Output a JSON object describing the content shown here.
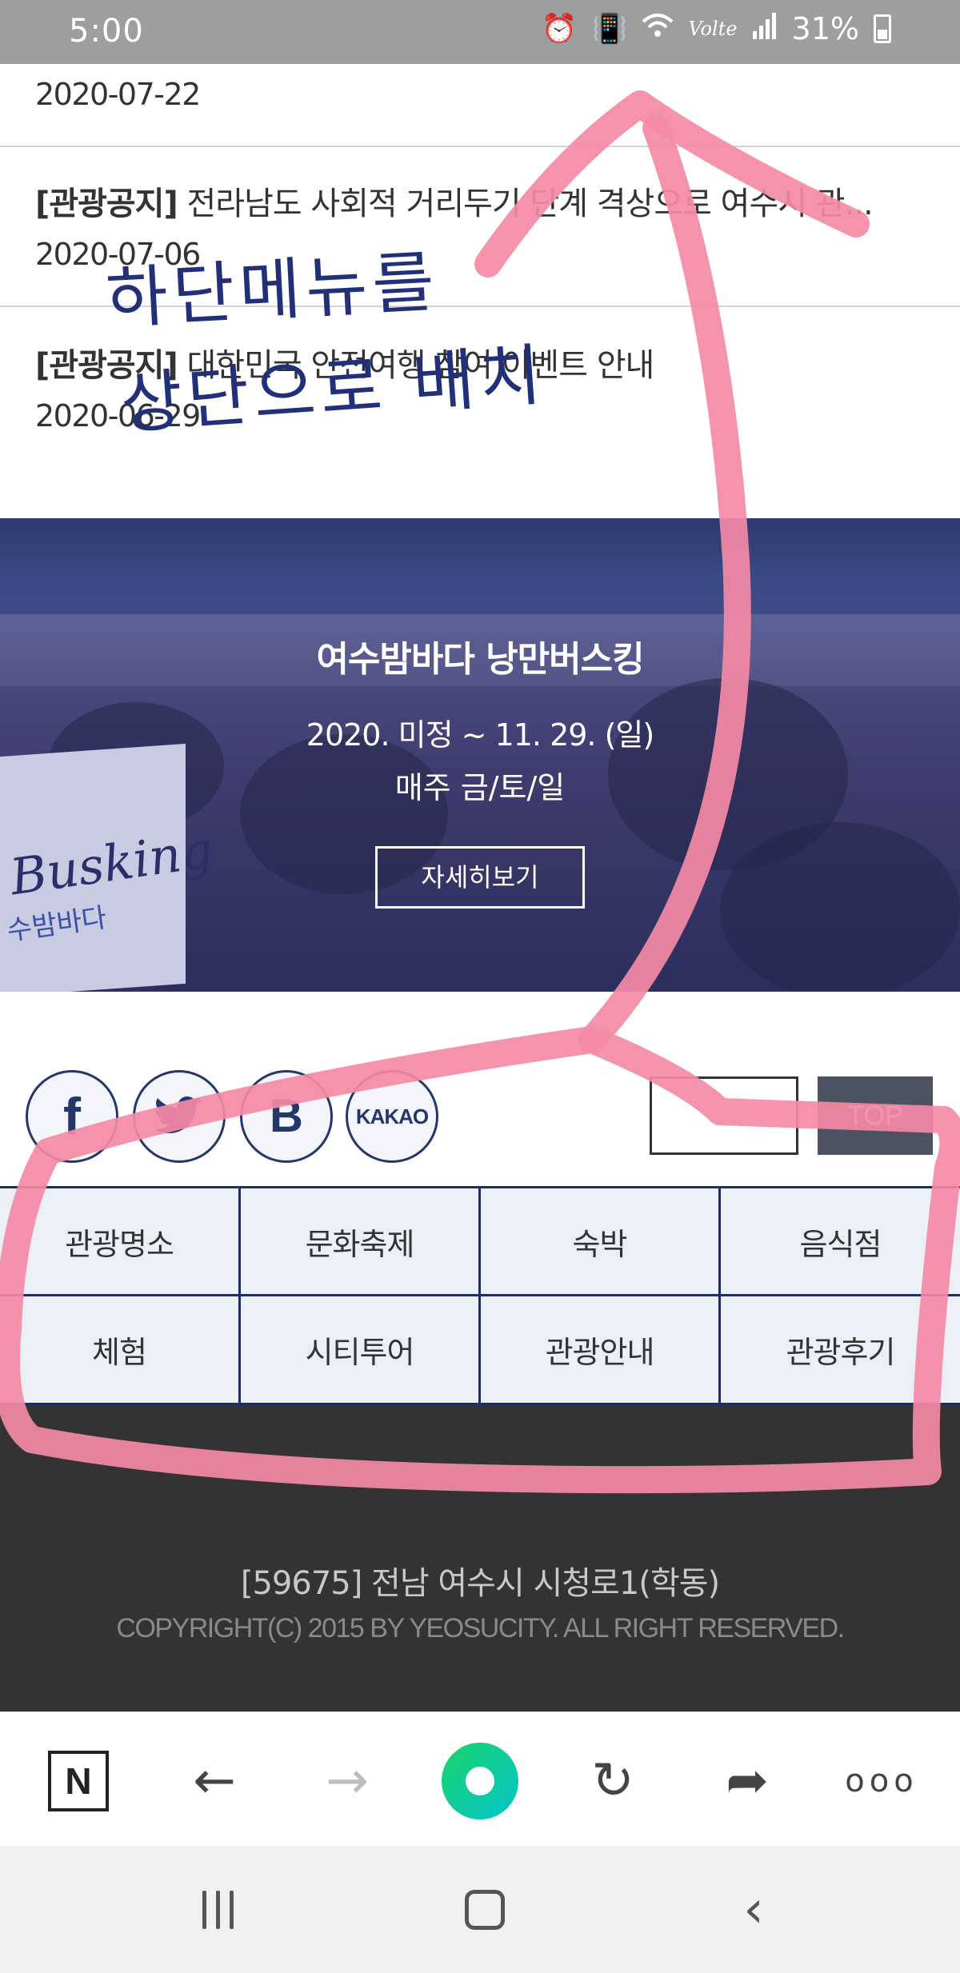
{
  "status_bar": {
    "time": "5:00",
    "battery": "31%",
    "network_label": "Volte",
    "icons": [
      "alarm-icon",
      "vibrate-icon",
      "wifi-icon",
      "signal-icon",
      "battery-icon"
    ]
  },
  "notices": {
    "first_date": "2020-07-22",
    "items": [
      {
        "tag": "[관광공지]",
        "title": "전라남도 사회적 거리두기 단계 격상으로 여수시 관...",
        "date": "2020-07-06"
      },
      {
        "tag": "[관광공지]",
        "title": "대한민국 안전여행 참여 이벤트 안내",
        "date": "2020-06-29"
      }
    ]
  },
  "banner": {
    "title": "여수밤바다 낭만버스킹",
    "date_range": "2020. 미정 ~ 11. 29. (일)",
    "days": "매주 금/토/일",
    "button": "자세히보기",
    "sign_text": "Busking",
    "sign_sub": "수밤바다"
  },
  "share": {
    "facebook": "f",
    "twitter": "🐦",
    "blog": "B",
    "kakao": "KAKAO",
    "top_button": "TOP"
  },
  "bottom_menu": {
    "items": [
      "관광명소",
      "문화축제",
      "숙박",
      "음식점",
      "체험",
      "시티투어",
      "관광안내",
      "관광후기"
    ]
  },
  "footer": {
    "address": "[59675] 전남 여수시 시청로1(학동)",
    "copyright": "COPYRIGHT(C) 2015 BY YEOSUCITY. ALL RIGHT RESERVED."
  },
  "browser_toolbar": {
    "naver_label": "N",
    "back": "←",
    "forward": "→",
    "refresh": "↻",
    "share": "➦",
    "more": "ooo"
  },
  "system_nav": {
    "back": "‹"
  },
  "annotation": {
    "line1": "하단메뉴를",
    "line2": "상단으로 배치",
    "color": "#f48aa6"
  }
}
